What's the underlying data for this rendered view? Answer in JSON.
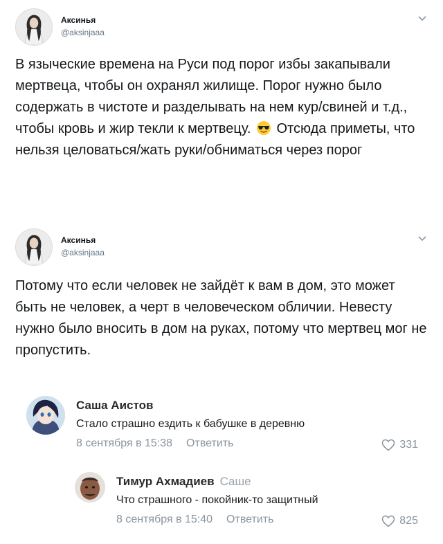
{
  "tweets": [
    {
      "author": "Аксинья",
      "handle": "@aksinjaaa",
      "text_before_emoji": "В языческие времена на Руси под порог избы закапывали мертвеца, чтобы он охранял жилище. Порог нужно было содержать в чистоте и разделывать на нем кур/свиней и т.д., чтобы кровь и жир текли к мертвецу.",
      "emoji": "smiling-face-with-sunglasses",
      "text_after_emoji": "Отсюда приметы, что нельзя целоваться/жать руки/обниматься через порог"
    },
    {
      "author": "Аксинья",
      "handle": "@aksinjaaa",
      "text": "Потому что если человек не зайдёт к вам в дом, это может быть не человек, а черт в человеческом обличии. Невесту нужно было вносить в дом на руках, потому что мертвец мог не пропустить."
    }
  ],
  "comments": [
    {
      "author": "Саша Аистов",
      "text": "Стало страшно ездить к бабушке в деревню",
      "date": "8 сентября в 15:38",
      "reply_label": "Ответить",
      "likes": "331"
    },
    {
      "author": "Тимур Ахмадиев",
      "reply_to": "Саше",
      "text": "Что страшного - покойник-то защитный",
      "date": "8 сентября в 15:40",
      "reply_label": "Ответить",
      "likes": "825"
    }
  ],
  "colors": {
    "text_primary": "#14171a",
    "text_secondary": "#657786",
    "meta_gray": "#8a939d"
  }
}
